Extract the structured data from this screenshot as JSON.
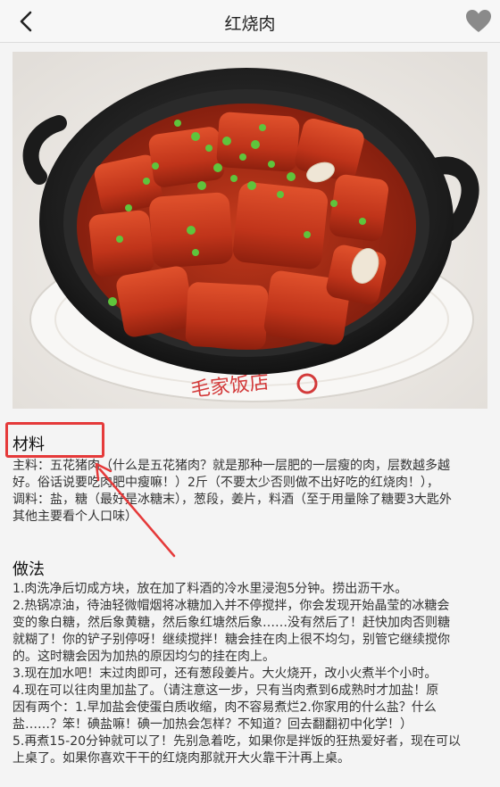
{
  "header": {
    "title": "红烧肉",
    "back_icon": "chevron-left-icon",
    "favorite_icon": "heart-icon"
  },
  "photo": {
    "stamp_text": "毛家饭店"
  },
  "ingredients": {
    "title": "材料",
    "line1": "主料：五花猪肉（什么是五花猪肉？就是那种一层肥的一层瘦的肉，层数越多越",
    "line2": "好。俗话说要吃肉肥中瘦嘛！）2斤（不要太少否则做不出好吃的红烧肉！），",
    "line3": "调料：盐，糖（最好是冰糖末），葱段，姜片，料酒（至于用量除了糖要3大匙外",
    "line4": "其他主要看个人口味）"
  },
  "steps": {
    "title": "做法",
    "lines": [
      "1.肉洗净后切成方块，放在加了料酒的冷水里浸泡5分钟。捞出沥干水。",
      "2.热锅凉油，待油轻微帽烟将冰糖加入并不停搅拌，你会发现开始晶莹的冰糖会",
      "变的象白糖，然后象黄糖，然后象红塘然后象……没有然后了！赶快加肉否则糖",
      "就糊了！你的铲子别停呀！继续搅拌！糖会挂在肉上很不均匀，别管它继续搅你",
      "的。这时糖会因为加热的原因均匀的挂在肉上。",
      "3.现在加水吧！末过肉即可，还有葱段姜片。大火烧开，改小火煮半个小时。",
      "4.现在可以往肉里加盐了。（请注意这一步，只有当肉煮到6成熟时才加盐！原",
      "因有两个：1.早加盐会使蛋白质收缩，肉不容易煮烂2.你家用的什么盐？什么",
      "盐……？笨！碘盐嘛！碘一加热会怎样？不知道？回去翻翻初中化学！）",
      "5.再煮15-20分钟就可以了！先别急着吃，如果你是拌饭的狂热爱好者，现在可以",
      "上桌了。如果你喜欢干干的红烧肉那就开大火靠干汁再上桌。"
    ]
  },
  "annotation": {
    "color": "#e53a3a"
  }
}
